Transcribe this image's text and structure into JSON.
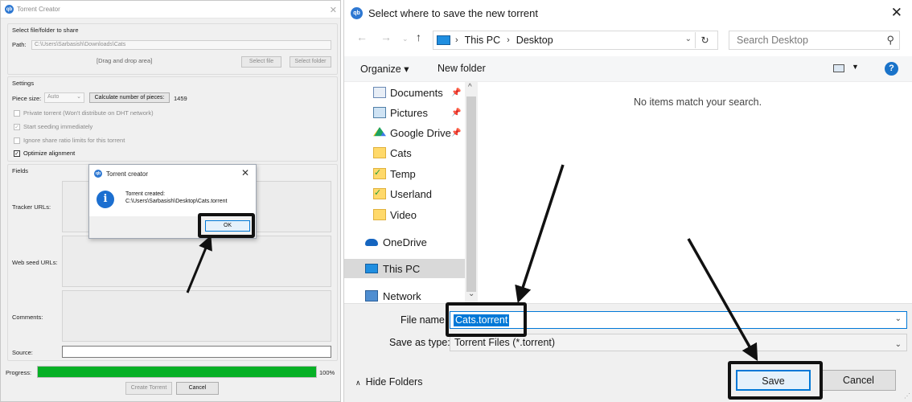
{
  "torrent_creator": {
    "title": "Torrent Creator",
    "select_group_label": "Select file/folder to share",
    "path_label": "Path:",
    "path_value": "C:\\Users\\Sarbasish\\Downloads\\Cats",
    "drop_area_label": "[Drag and drop area]",
    "select_file_label": "Select file",
    "select_folder_label": "Select folder",
    "settings_label": "Settings",
    "piece_size_label": "Piece size:",
    "piece_size_value": "Auto",
    "calc_pieces_label": "Calculate number of pieces:",
    "pieces_count": "1459",
    "options": [
      {
        "label": "Private torrent (Won't distribute on DHT network)",
        "checked": false
      },
      {
        "label": "Start seeding immediately",
        "checked": true
      },
      {
        "label": "Ignore share ratio limits for this torrent",
        "checked": false
      },
      {
        "label": "Optimize alignment",
        "checked": true
      }
    ],
    "fields_label": "Fields",
    "tracker_urls_label": "Tracker URLs:",
    "web_seed_urls_label": "Web seed URLs:",
    "comments_label": "Comments:",
    "source_label": "Source:",
    "progress_label": "Progress:",
    "progress_percent": 100,
    "progress_text": "100%",
    "create_torrent_label": "Create Torrent",
    "cancel_label": "Cancel",
    "progress_color": "#06b025"
  },
  "message_box": {
    "title": "Torrent creator",
    "line1": "Torrent created:",
    "line2": "C:\\Users\\Sarbasish\\Desktop\\Cats.torrent",
    "ok_label": "OK"
  },
  "save_dialog": {
    "title": "Select where to save the new torrent",
    "breadcrumb": [
      "This PC",
      "Desktop"
    ],
    "search_placeholder": "Search Desktop",
    "organize_label": "Organize ▾",
    "new_folder_label": "New folder",
    "nav_items": [
      {
        "label": "Documents",
        "pinned": true
      },
      {
        "label": "Pictures",
        "pinned": true
      },
      {
        "label": "Google Drive",
        "pinned": true
      },
      {
        "label": "Cats",
        "pinned": false
      },
      {
        "label": "Temp",
        "pinned": false
      },
      {
        "label": "Userland",
        "pinned": false
      },
      {
        "label": "Video",
        "pinned": false
      },
      {
        "label": "OneDrive",
        "pinned": false
      },
      {
        "label": "This PC",
        "pinned": false
      },
      {
        "label": "Network",
        "pinned": false
      }
    ],
    "empty_message": "No items match your search.",
    "file_name_label": "File name:",
    "file_name_value": "Cats.torrent",
    "save_as_type_label": "Save as type:",
    "save_as_type_value": "Torrent Files (*.torrent)",
    "hide_folders_label": "Hide Folders",
    "save_label": "Save",
    "cancel_label": "Cancel",
    "accent_color": "#0078d7"
  }
}
